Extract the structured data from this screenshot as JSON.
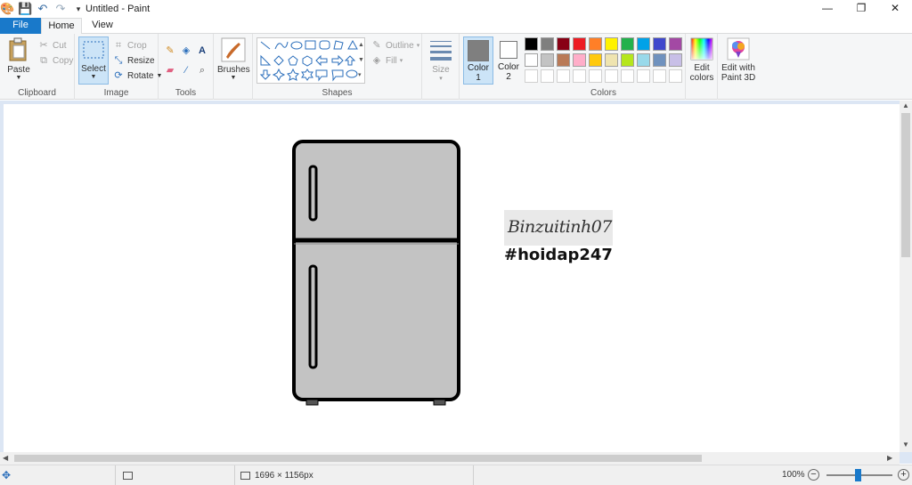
{
  "window": {
    "title": "Untitled - Paint",
    "minimize": "—",
    "restore": "❐",
    "close": "✕"
  },
  "tabs": [
    {
      "label": "File"
    },
    {
      "label": "Home"
    },
    {
      "label": "View"
    }
  ],
  "ribbon": {
    "clipboard": {
      "label": "Clipboard",
      "paste": "Paste",
      "cut": "Cut",
      "copy": "Copy"
    },
    "image": {
      "label": "Image",
      "select": "Select",
      "crop": "Crop",
      "resize": "Resize",
      "rotate": "Rotate"
    },
    "tools": {
      "label": "Tools"
    },
    "brushes": {
      "label": "Brushes"
    },
    "shapes": {
      "label": "Shapes",
      "outline": "Outline",
      "fill": "Fill"
    },
    "size": {
      "label": "Size"
    },
    "color1": {
      "label": "Color",
      "sub": "1",
      "color": "#7f7f7f"
    },
    "color2": {
      "label": "Color",
      "sub": "2",
      "color": "#ffffff"
    },
    "colors": {
      "label": "Colors",
      "row1": [
        "#000000",
        "#7f7f7f",
        "#880015",
        "#ed1c24",
        "#ff7f27",
        "#fff200",
        "#22b14c",
        "#00a2e8",
        "#3f48cc",
        "#a349a4"
      ],
      "row2": [
        "#ffffff",
        "#c3c3c3",
        "#b97a57",
        "#ffaec9",
        "#ffc90e",
        "#efe4b0",
        "#b5e61d",
        "#99d9ea",
        "#7092be",
        "#c8bfe7"
      ]
    },
    "edit_colors": {
      "line1": "Edit",
      "line2": "colors"
    },
    "paint3d": {
      "line1": "Edit with",
      "line2": "Paint 3D"
    }
  },
  "canvas": {
    "signature": "Binzuitinh07",
    "hashtag": "#hoidap247"
  },
  "status": {
    "dimensions": "1696 × 1156px",
    "zoom": "100%"
  }
}
